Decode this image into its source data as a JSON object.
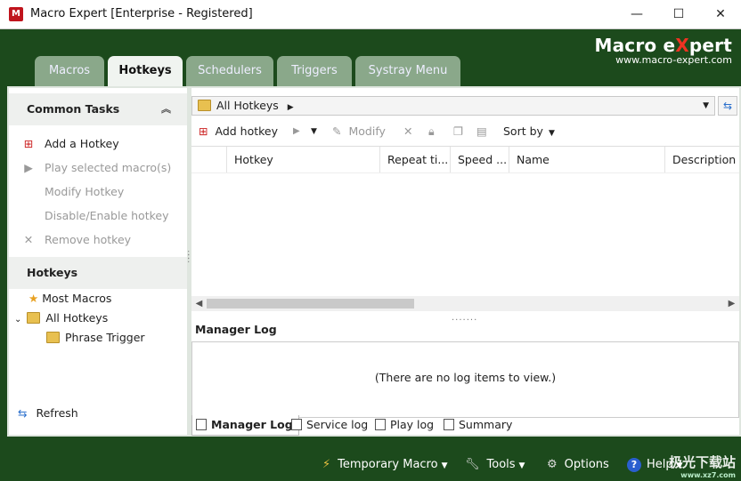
{
  "window": {
    "title": "Macro Expert [Enterprise - Registered]",
    "minimize": "—",
    "maximize": "☐",
    "close": "✕"
  },
  "brand": {
    "name_part1": "Macro e",
    "name_x": "X",
    "name_part2": "pert",
    "url": "www.macro-expert.com"
  },
  "tabs": [
    {
      "label": "Macros"
    },
    {
      "label": "Hotkeys",
      "active": true
    },
    {
      "label": "Schedulers"
    },
    {
      "label": "Triggers"
    },
    {
      "label": "Systray Menu"
    }
  ],
  "left": {
    "common_tasks_title": "Common Tasks",
    "tasks": [
      {
        "label": "Add a Hotkey",
        "enabled": true
      },
      {
        "label": "Play selected macro(s)",
        "enabled": false
      },
      {
        "label": "Modify Hotkey",
        "enabled": false
      },
      {
        "label": "Disable/Enable hotkey",
        "enabled": false
      },
      {
        "label": "Remove hotkey",
        "enabled": false
      }
    ],
    "hotkeys_title": "Hotkeys",
    "tree": [
      {
        "label": "Most Macros"
      },
      {
        "label": "All Hotkeys"
      },
      {
        "label": "Phrase Trigger"
      }
    ],
    "refresh": "Refresh"
  },
  "right": {
    "address": "All Hotkeys",
    "toolbar": {
      "add": "Add hotkey",
      "modify": "Modify",
      "sort": "Sort by"
    },
    "columns": [
      "Hotkey",
      "Repeat ti...",
      "Speed ...",
      "Name",
      "Description"
    ],
    "log_title": "Manager Log",
    "log_empty": "(There are no log items to view.)",
    "log_tabs": [
      "Manager Log",
      "Service log",
      "Play log",
      "Summary"
    ]
  },
  "bottom": {
    "temporary_macro": "Temporary Macro",
    "tools": "Tools",
    "options": "Options",
    "help": "Help"
  },
  "watermark": {
    "text": "极光下载站",
    "sub": "www.xz7.com"
  }
}
